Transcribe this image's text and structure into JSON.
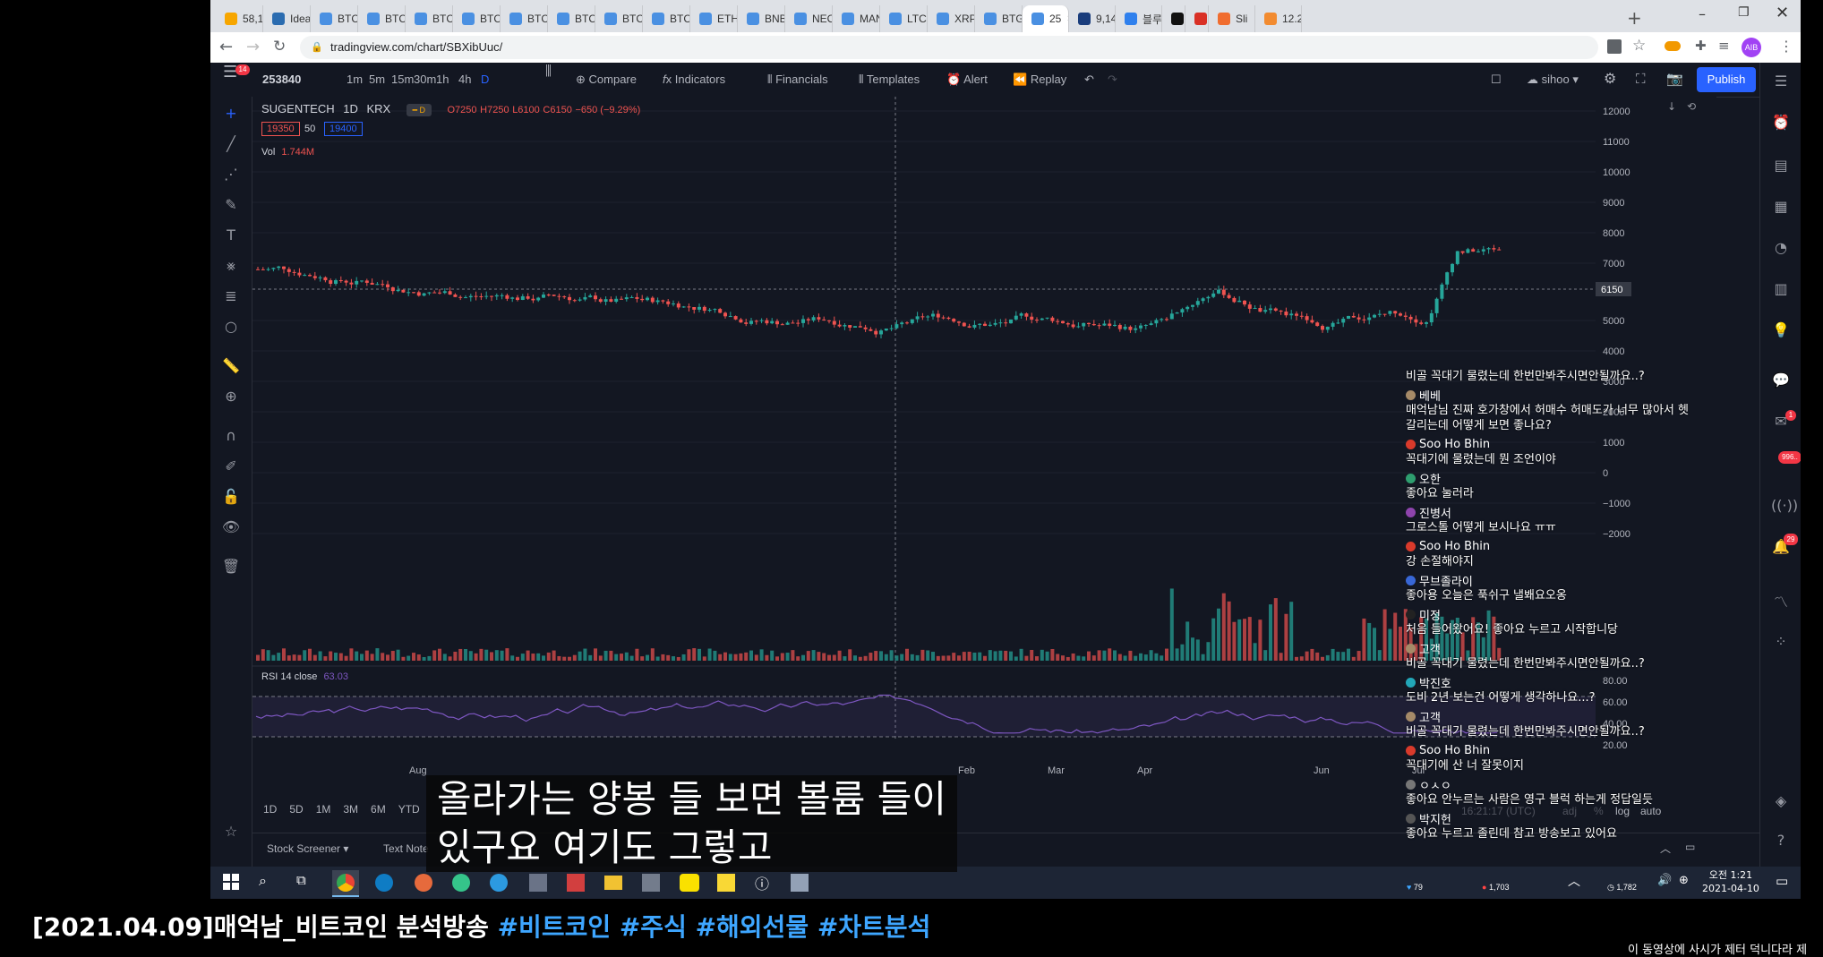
{
  "browser": {
    "tabs": [
      "58,12:",
      "Ideas",
      "BTCU",
      "BTCU",
      "BTCU",
      "BTCU",
      "BTCU",
      "BTCU",
      "BTCU",
      "BTCU",
      "ETHU",
      "BNBU",
      "NEOU",
      "MANA",
      "LTCU",
      "XRPU",
      "BTGU",
      "25",
      "9,145",
      "블루",
      "",
      "[L",
      "Sli",
      "12.22"
    ],
    "url": "tradingview.com/chart/SBXibUuc/",
    "profile": "AIB"
  },
  "toolbar": {
    "menu_badge": "14",
    "symbol_search": "253840",
    "intervals": [
      "1m",
      "5m",
      "15m",
      "30m",
      "1h",
      "4h",
      "D"
    ],
    "compare": "Compare",
    "indicators": "Indicators",
    "financials": "Financials",
    "templates": "Templates",
    "alert": "Alert",
    "replay": "Replay",
    "layout_user": "sihoo",
    "publish": "Publish"
  },
  "legend": {
    "symbol": "SUGENTECH",
    "interval": "1D",
    "exchange": "KRX",
    "open": "O7250",
    "high": "H7250",
    "low": "L6100",
    "close": "C6150",
    "change": "−650 (−9.29%)",
    "bid": "19350",
    "spread": "50",
    "ask": "19400",
    "vol_label": "Vol",
    "vol_value": "1.744M",
    "rsi_label": "RSI 14 close",
    "rsi_value": "63.03"
  },
  "price_axis": [
    "12000",
    "11000",
    "10000",
    "9000",
    "8000",
    "7000",
    "5000",
    "4000",
    "3000",
    "2000",
    "1000",
    "0",
    "−1000",
    "−2000"
  ],
  "current_price": "6150",
  "rsi_axis": [
    "80.00",
    "60.00",
    "40.00",
    "20.00"
  ],
  "time_axis": [
    "Aug",
    "Feb",
    "Mar",
    "Apr",
    "Jun",
    "Jul"
  ],
  "bottom": {
    "ranges": [
      "1D",
      "5D",
      "1M",
      "3M",
      "6M",
      "YTD"
    ],
    "time": "16:21:17 (UTC)",
    "adj": "adj",
    "pct": "%",
    "log": "log",
    "auto": "auto",
    "tabs": [
      "Stock Screener",
      "Text Note"
    ]
  },
  "right_badges": {
    "notif": "1",
    "count": "996..",
    "alert": "29"
  },
  "chat": [
    {
      "name": "",
      "msg": "비골 꼭대기 물렸는데 한번만봐주시면안될까요..?"
    },
    {
      "name": "베베",
      "msg": "매억남님 진짜 호가창에서 허매수 허매도가 너무 많아서 헷갈리는데 어떻게 보면 좋나요?"
    },
    {
      "name": "Soo Ho Bhin",
      "msg": "꼭대기에 물렸는데 뭔 조언이야"
    },
    {
      "name": "오한",
      "msg": "좋아요 눌러라"
    },
    {
      "name": "진병서",
      "msg": "그로스톨 어떻게 보시나요 ㅠㅠ"
    },
    {
      "name": "Soo Ho Bhin",
      "msg": "강 손절해야지"
    },
    {
      "name": "무브졸라이",
      "msg": "좋아용 오늘은 푹쉬구 낼봬요오옹"
    },
    {
      "name": "미정",
      "msg": "처음 들어왔어요! 좋아요 누르고 시작합니당"
    },
    {
      "name": "고객",
      "msg": "비골 꼭대기 물렸는데 한번만봐주시면안될까요..?"
    },
    {
      "name": "박진호",
      "msg": "도비 2년 보는건 어떻게 생각하나요...?"
    },
    {
      "name": "고객",
      "msg": "비골 꼭대기 물렸는데 한번만봐주시면안될까요..?"
    },
    {
      "name": "Soo Ho Bhin",
      "msg": "꼭대기에 산 너 잘못이지"
    },
    {
      "name": "ㅇㅅㅇ",
      "msg": "좋아요 안누르는 사람은 영구 블럭 하는게 정답일듯"
    },
    {
      "name": "박지헌",
      "msg": "좋아요 누르고 졸린데 참고 방송보고 있어요"
    }
  ],
  "taskbar": {
    "time": "오전 1:21",
    "date": "2021-04-10",
    "stat_a": "79",
    "stat_b": "1,703",
    "stat_c": "1,782"
  },
  "subtitle": {
    "line1": "올라가는 양봉 들 보면 볼륨 들이",
    "line2": "있구요 여기도 그렇고"
  },
  "video_title": {
    "main": "[2021.04.09]매억남_비트코인 분석방송",
    "tags": "#비트코인 #주식 #해외선물 #차트분석"
  },
  "ticker_text": "이 동영상에 사시가 제터 덕니다라 제",
  "colors": {
    "up": "#26a69a",
    "down": "#ef5350",
    "bg": "#131722",
    "rsi": "#7e57c2",
    "publish": "#2962ff"
  }
}
